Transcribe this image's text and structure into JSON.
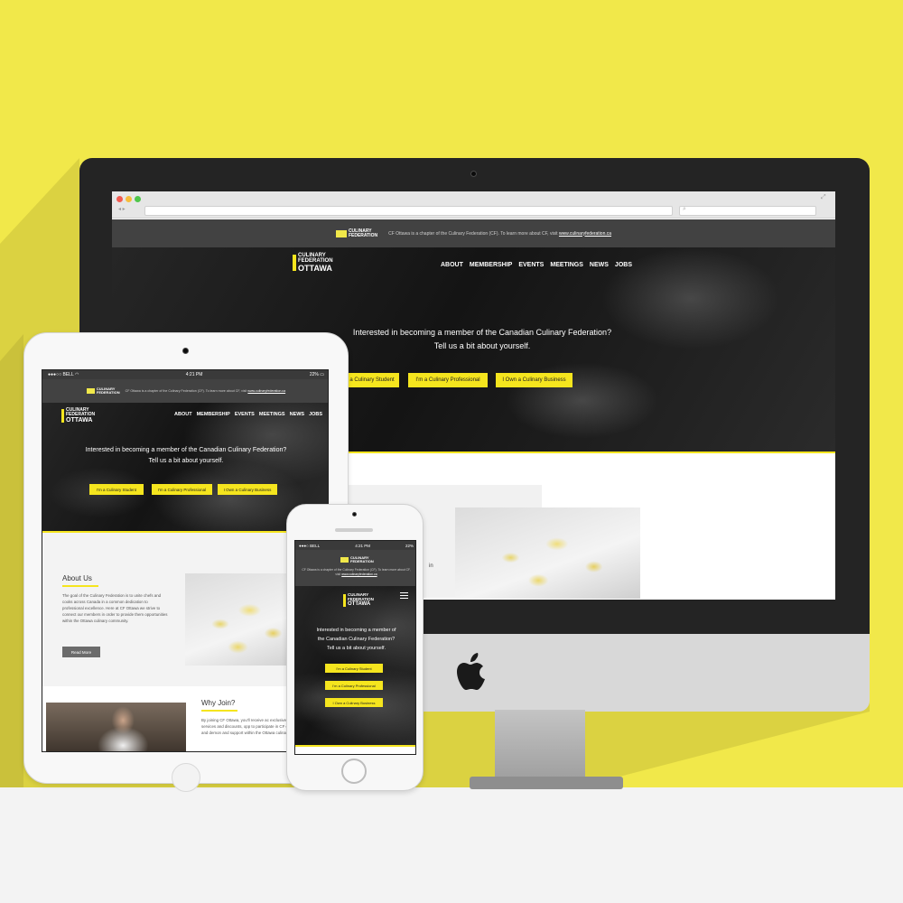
{
  "site": {
    "topbar": {
      "logo_line1": "CULINARY",
      "logo_line2": "FEDERATION",
      "note_prefix": "CF Ottawa is a chapter of the Culinary Federation (CF). To learn more about CF, visit",
      "note_link": "www.culinaryfederation.ca"
    },
    "logo": {
      "line1": "CULINARY",
      "line2": "FEDERATION",
      "line3": "OTTAWA"
    },
    "nav": [
      "ABOUT",
      "MEMBERSHIP",
      "EVENTS",
      "MEETINGS",
      "NEWS",
      "JOBS"
    ],
    "hero": {
      "title_line1": "Interested in becoming a member of the Canadian Culinary Federation?",
      "title_line2": "Tell us a bit about yourself.",
      "phone_line1": "Interested in becoming a member of",
      "phone_line2": "the Canadian Culinary Federation?",
      "phone_line3": "Tell us a bit about yourself."
    },
    "cta": {
      "student": "I'm a Culinary Student",
      "professional": "I'm a Culinary Professional",
      "business": "I Own a Culinary Business",
      "student_cut": "a Culinary Student"
    },
    "about": {
      "heading": "About Us",
      "body": "The goal of the Culinary Federation is to unite chefs and cooks across Canada in a common dedication to professional excellence. Here at CF Ottawa we strive to connect our members in order to provide them opportunities within the Ottawa culinary community.",
      "button": "Read More"
    },
    "why": {
      "heading": "Why Join?",
      "body": "By joining CF Ottawa, you'll receive ac exclusive services and discounts, opp to participate in CF events and demon and support within the Ottawa culinary"
    },
    "imac_fragment": "in"
  },
  "devices": {
    "status": {
      "carrier": "BELL",
      "time": "4:21 PM",
      "battery": "22%"
    }
  },
  "colors": {
    "accent": "#f5e51e",
    "backdrop": "#f1e84a",
    "dark": "#1c1c1c",
    "bar": "#424242"
  },
  "icons": [
    "camera-icon",
    "apple-logo-icon",
    "hamburger-icon",
    "battery-icon",
    "wifi-icon",
    "maple-leaf-icon",
    "home-button-icon"
  ]
}
